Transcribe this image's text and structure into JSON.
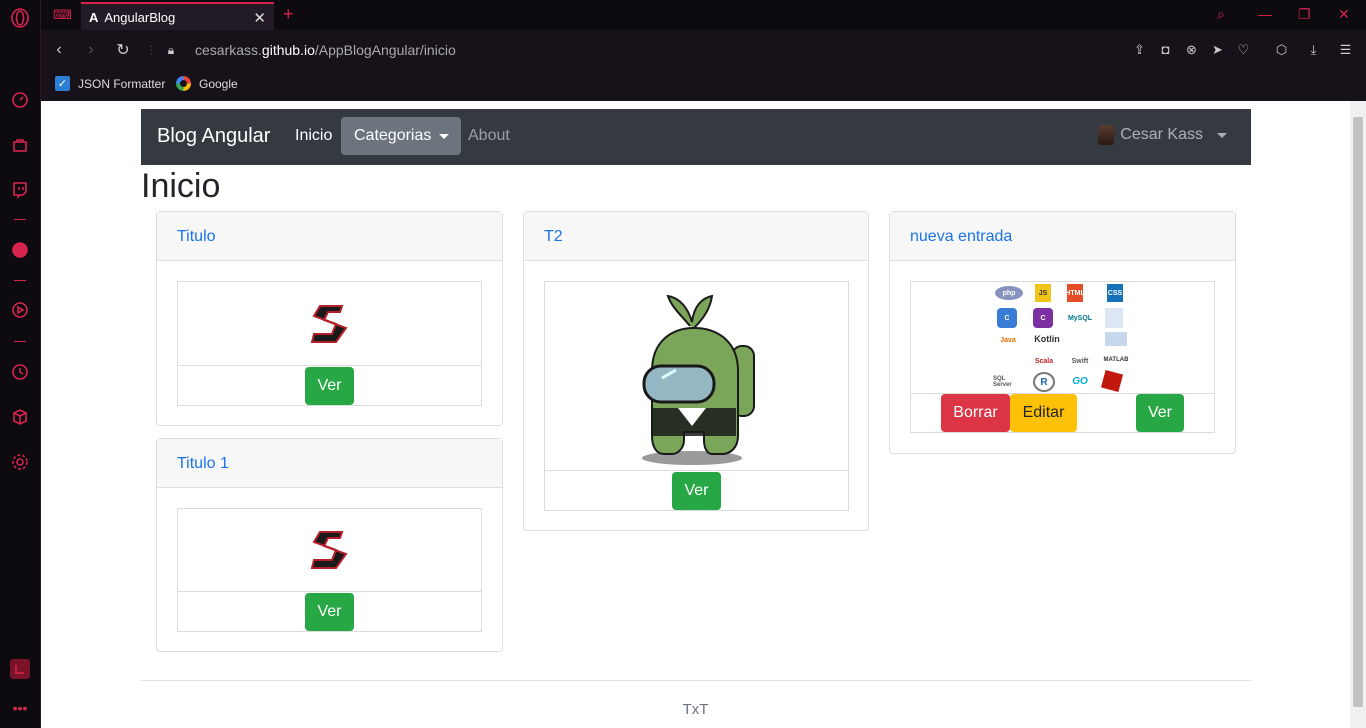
{
  "browser": {
    "tab_title": "AngularBlog",
    "url_host": "cesarkass.github.io",
    "url_path": "/AppBlogAngular/inicio",
    "bookmarks": [
      {
        "label": "JSON Formatter",
        "icon": "checkbox-icon"
      },
      {
        "label": "Google",
        "icon": "google-icon"
      }
    ]
  },
  "navbar": {
    "brand": "Blog Angular",
    "links": [
      {
        "label": "Inicio",
        "active": true
      },
      {
        "label": "Categorias",
        "dropdown": true
      },
      {
        "label": "About",
        "active": false
      }
    ],
    "user": "Cesar Kass"
  },
  "page": {
    "title": "Inicio",
    "footer": "TxT"
  },
  "posts": [
    {
      "title": "Titulo",
      "image": "s-logo",
      "buttons": [
        "Ver"
      ]
    },
    {
      "title": "Titulo 1",
      "image": "s-logo",
      "buttons": [
        "Ver"
      ]
    },
    {
      "title": "T2",
      "image": "green-crewmate-sprout",
      "buttons": [
        "Ver"
      ]
    },
    {
      "title": "nueva entrada",
      "image": "programming-languages-collage",
      "buttons": [
        "Borrar",
        "Editar",
        "Ver"
      ],
      "collage_labels": [
        "php",
        "JS",
        "HTML",
        "CSS",
        "C",
        "C",
        "MySQL",
        "Java",
        "Kotlin",
        "Scala",
        "Swift",
        "MATLAB",
        "SQL Server",
        "R",
        "GO"
      ]
    }
  ],
  "colors": {
    "opera_accent": "#d6244f",
    "navbar_bg": "#343a40",
    "btn_success": "#28a745",
    "btn_danger": "#dc3545",
    "btn_warning": "#ffc107",
    "link": "#1a73e8"
  }
}
